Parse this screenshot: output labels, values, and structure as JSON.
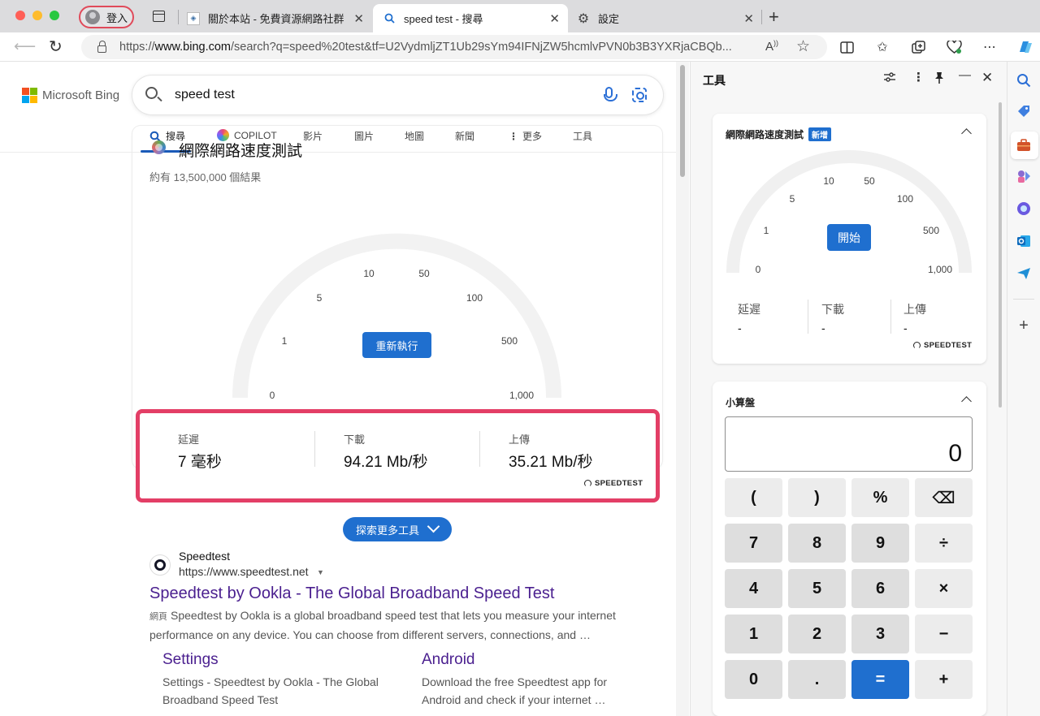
{
  "tabs": {
    "profile_label": "登入",
    "items": [
      {
        "title": "關於本站 - 免費資源網路社群",
        "favicon": "site-icon"
      },
      {
        "title": "speed test - 搜尋",
        "favicon": "search-icon"
      },
      {
        "title": "設定",
        "favicon": "gear-icon"
      }
    ],
    "close_glyph": "✕",
    "new_tab_glyph": "+"
  },
  "address_bar": {
    "url_prefix": "https://",
    "url_host": "www.bing.com",
    "url_rest": "/search?q=speed%20test&tf=U2VydmljZT1Ub29sYm94IFNjZW5hcmlvPVN0b3B3YXRjaCBQb..."
  },
  "bing": {
    "logo_text": "Microsoft Bing",
    "search_query": "speed test",
    "scope_tabs": [
      "搜尋",
      "COPILOT",
      "影片",
      "圖片",
      "地圖",
      "新聞",
      "更多",
      "工具"
    ],
    "result_count": "約有 13,500,000 個結果"
  },
  "speed_answer": {
    "title": "網際網路速度測試",
    "gauge_ticks": [
      "0",
      "1",
      "5",
      "10",
      "50",
      "100",
      "500",
      "1,000"
    ],
    "rerun_label": "重新執行",
    "metrics": [
      {
        "label": "延遲",
        "value": "7 毫秒"
      },
      {
        "label": "下載",
        "value": "94.21 Mb/秒"
      },
      {
        "label": "上傳",
        "value": "35.21 Mb/秒"
      }
    ],
    "brand": "SPEEDTEST",
    "explore_label": "探索更多工具"
  },
  "result": {
    "site_name": "Speedtest",
    "url": "https://www.speedtest.net",
    "title": "Speedtest by Ookla - The Global Broadband Speed Test",
    "tag": "網頁",
    "snippet": "Speedtest by Ookla is a global broadband speed test that lets you measure your internet performance on any device. You can choose from different servers, connections, and …",
    "sublinks": [
      {
        "title": "Settings",
        "text": "Settings - Speedtest by Ookla - The Global Broadband Speed Test"
      },
      {
        "title": "Android",
        "text": "Download the free Speedtest app for Android and check if your internet …"
      }
    ]
  },
  "tools_panel": {
    "title": "工具",
    "speed_card": {
      "title": "網際網路速度測試",
      "badge": "新增",
      "gauge_ticks": [
        "0",
        "1",
        "5",
        "10",
        "50",
        "100",
        "500",
        "1,000"
      ],
      "start_label": "開始",
      "metrics": [
        {
          "label": "延遲",
          "value": "-"
        },
        {
          "label": "下載",
          "value": "-"
        },
        {
          "label": "上傳",
          "value": "-"
        }
      ],
      "brand": "SPEEDTEST"
    },
    "calculator": {
      "title": "小算盤",
      "display": "0",
      "keys": [
        [
          "(",
          ")",
          "%",
          "⌫"
        ],
        [
          "7",
          "8",
          "9",
          "÷"
        ],
        [
          "4",
          "5",
          "6",
          "×"
        ],
        [
          "1",
          "2",
          "3",
          "−"
        ],
        [
          "0",
          ".",
          "=",
          "+"
        ]
      ]
    }
  },
  "colors": {
    "accent": "#1f6fcf",
    "highlight_border": "#e33e66",
    "link_visited": "#4a1f8f"
  }
}
